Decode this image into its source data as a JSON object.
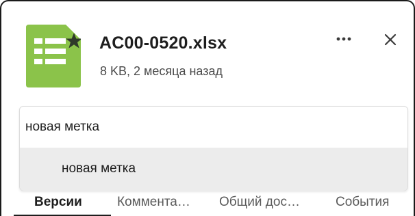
{
  "file": {
    "name": "AC00-0520.xlsx",
    "meta": "8 KB, 2 месяца назад",
    "icon": "spreadsheet-icon",
    "starred": true
  },
  "header_actions": {
    "more_icon": "more-horizontal-icon",
    "close_icon": "close-icon"
  },
  "tag_input": {
    "value": "новая метка",
    "suggestion": "новая метка"
  },
  "tabs": [
    {
      "label": "Версии",
      "active": true
    },
    {
      "label": "Коммента…",
      "active": false
    },
    {
      "label": "Общий дос…",
      "active": false
    },
    {
      "label": "События",
      "active": false
    }
  ],
  "colors": {
    "file_icon_green": "#8bc34a",
    "star": "#2f3a2a",
    "suggestion_bg": "#ececec"
  }
}
